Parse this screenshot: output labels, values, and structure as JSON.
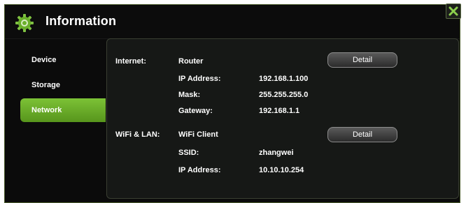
{
  "header": {
    "title": "Information"
  },
  "sidebar": {
    "items": [
      {
        "label": "Device"
      },
      {
        "label": "Storage"
      },
      {
        "label": "Network"
      }
    ]
  },
  "internet": {
    "section_label": "Internet:",
    "mode": "Router",
    "detail_label": "Detail",
    "fields": [
      {
        "label": "IP Address:",
        "value": "192.168.1.100"
      },
      {
        "label": "Mask:",
        "value": "255.255.255.0"
      },
      {
        "label": "Gateway:",
        "value": "192.168.1.1"
      }
    ]
  },
  "wifi": {
    "section_label": "WiFi & LAN:",
    "mode": "WiFi Client",
    "detail_label": "Detail",
    "fields": [
      {
        "label": "SSID:",
        "value": "zhangwei"
      },
      {
        "label": "IP Address:",
        "value": "10.10.10.254"
      }
    ]
  },
  "colors": {
    "accent": "#6aaf2b",
    "background": "#0b0b0b",
    "panel": "#161816"
  },
  "icons": {
    "logo": "gear-icon",
    "close": "close-icon"
  }
}
